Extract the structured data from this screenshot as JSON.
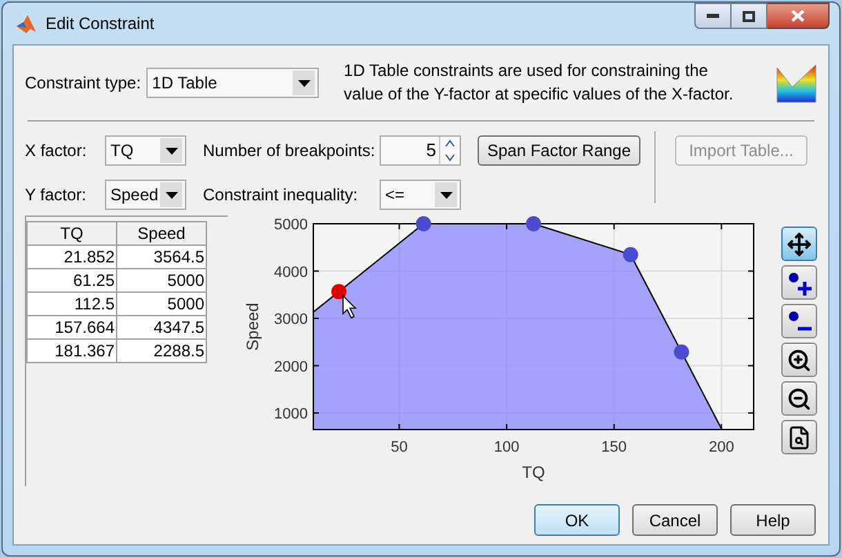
{
  "window": {
    "title": "Edit Constraint"
  },
  "constraint_type": {
    "label": "Constraint type:",
    "value": "1D Table"
  },
  "description": "1D Table constraints are used for constraining the value of the Y-factor at specific values of the X-factor.",
  "x_factor": {
    "label": "X factor:",
    "value": "TQ"
  },
  "breakpoints": {
    "label": "Number of breakpoints:",
    "value": "5"
  },
  "span_button": {
    "label": "Span Factor Range"
  },
  "import_button": {
    "label": "Import Table...",
    "disabled": true
  },
  "y_factor": {
    "label": "Y factor:",
    "value": "Speed"
  },
  "inequality": {
    "label": "Constraint inequality:",
    "value": "<="
  },
  "table": {
    "columns": [
      "TQ",
      "Speed"
    ],
    "rows": [
      [
        "21.852",
        "3564.5"
      ],
      [
        "61.25",
        "5000"
      ],
      [
        "112.5",
        "5000"
      ],
      [
        "157.664",
        "4347.5"
      ],
      [
        "181.367",
        "2288.5"
      ]
    ]
  },
  "plot": {
    "point_selected": [
      true,
      false,
      false,
      false,
      false
    ],
    "chart_data": {
      "type": "area",
      "xlabel": "TQ",
      "ylabel": "Speed",
      "grid": true,
      "x": [
        10,
        21.9,
        61.3,
        112.5,
        157.7,
        181.4,
        200.2
      ],
      "values": [
        3133,
        3565,
        5000,
        5000,
        4348,
        2289,
        650
      ],
      "xlim": [
        10,
        215
      ],
      "ylim": [
        650,
        5000
      ],
      "xticks": [
        50,
        100,
        150,
        200
      ],
      "yticks": [
        1000,
        2000,
        3000,
        4000,
        5000
      ]
    }
  },
  "toolbar": [
    {
      "kind": "pan",
      "selected": true
    },
    {
      "kind": "add",
      "selected": false
    },
    {
      "kind": "remove",
      "selected": false
    },
    {
      "kind": "zoom_in",
      "selected": false
    },
    {
      "kind": "zoom_out",
      "selected": false
    },
    {
      "kind": "zoom_fit",
      "selected": false
    }
  ],
  "buttons": [
    {
      "label": "OK",
      "default": true
    },
    {
      "label": "Cancel",
      "default": false
    },
    {
      "label": "Help",
      "default": false
    }
  ]
}
